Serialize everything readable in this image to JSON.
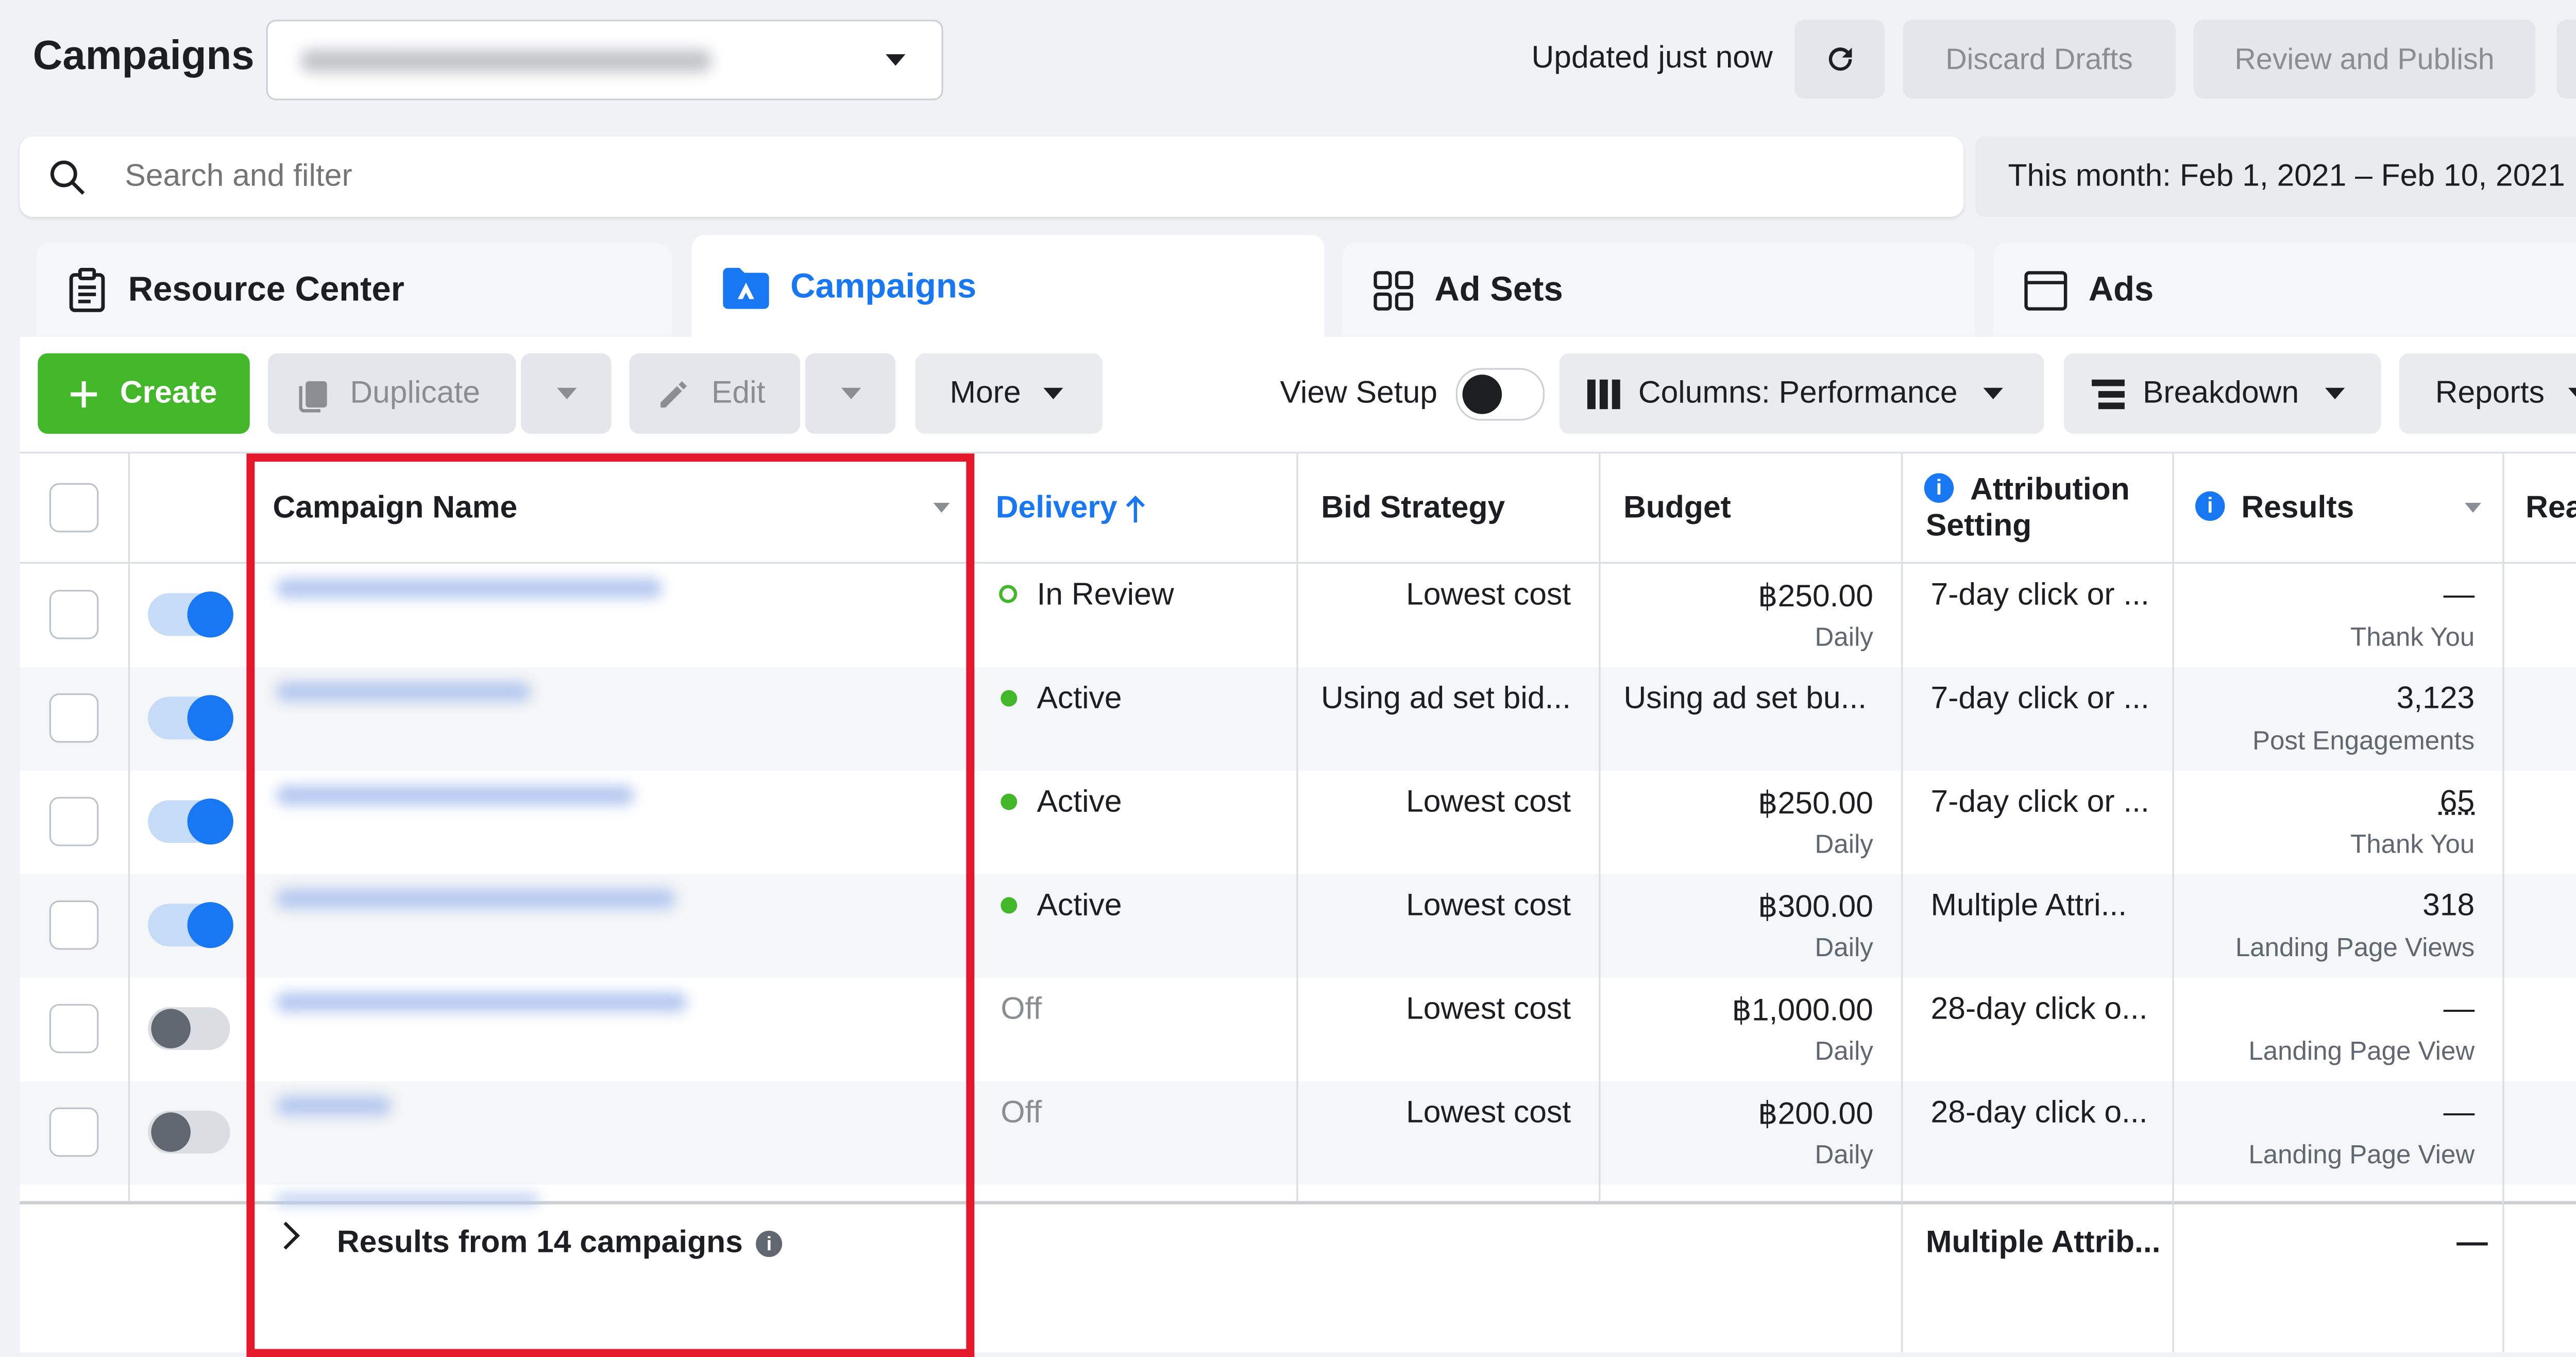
{
  "header": {
    "title": "Campaigns",
    "updated": "Updated just now",
    "discard_label": "Discard Drafts",
    "review_label": "Review and Publish"
  },
  "search": {
    "placeholder": "Search and filter",
    "date_range": "This month: Feb 1, 2021 – Feb 10, 2021"
  },
  "tabs": [
    {
      "label": "Resource Center"
    },
    {
      "label": "Campaigns"
    },
    {
      "label": "Ad Sets"
    },
    {
      "label": "Ads"
    }
  ],
  "toolbar": {
    "create": "Create",
    "duplicate": "Duplicate",
    "edit": "Edit",
    "more": "More",
    "view_setup": "View Setup",
    "columns": "Columns: Performance",
    "breakdown": "Breakdown",
    "reports": "Reports"
  },
  "table": {
    "columns": {
      "name": "Campaign Name",
      "delivery": "Delivery",
      "bid": "Bid Strategy",
      "budget": "Budget",
      "attr1": "Attribution",
      "attr2": "Setting",
      "results": "Results",
      "reach": "Rea"
    },
    "rows": [
      {
        "delivery": "In Review",
        "bid": "Lowest cost",
        "budget": "฿250.00",
        "budget_sub": "Daily",
        "attr": "7-day click or ...",
        "results": "—",
        "results_sub": "Thank You"
      },
      {
        "delivery": "Active",
        "bid": "Using ad set bid...",
        "budget": "Using ad set bu...",
        "budget_sub": "",
        "attr": "7-day click or ...",
        "results": "3,123",
        "results_sub": "Post Engagements"
      },
      {
        "delivery": "Active",
        "bid": "Lowest cost",
        "budget": "฿250.00",
        "budget_sub": "Daily",
        "attr": "7-day click or ...",
        "results": "65",
        "results_sub": "Thank You"
      },
      {
        "delivery": "Active",
        "bid": "Lowest cost",
        "budget": "฿300.00",
        "budget_sub": "Daily",
        "attr": "Multiple Attri...",
        "results": "318",
        "results_sub": "Landing Page Views"
      },
      {
        "delivery": "Off",
        "bid": "Lowest cost",
        "budget": "฿1,000.00",
        "budget_sub": "Daily",
        "attr": "28-day click o...",
        "results": "—",
        "results_sub": "Landing Page View"
      },
      {
        "delivery": "Off",
        "bid": "Lowest cost",
        "budget": "฿200.00",
        "budget_sub": "Daily",
        "attr": "28-day click o...",
        "results": "—",
        "results_sub": "Landing Page View"
      }
    ],
    "footer": {
      "summary": "Results from 14 campaigns",
      "attr": "Multiple Attrib...",
      "results": "—"
    }
  },
  "colors": {
    "accent": "#1877f2",
    "create_green": "#42b72a",
    "highlight_red": "#e4172b",
    "active_green": "#42b72a"
  }
}
